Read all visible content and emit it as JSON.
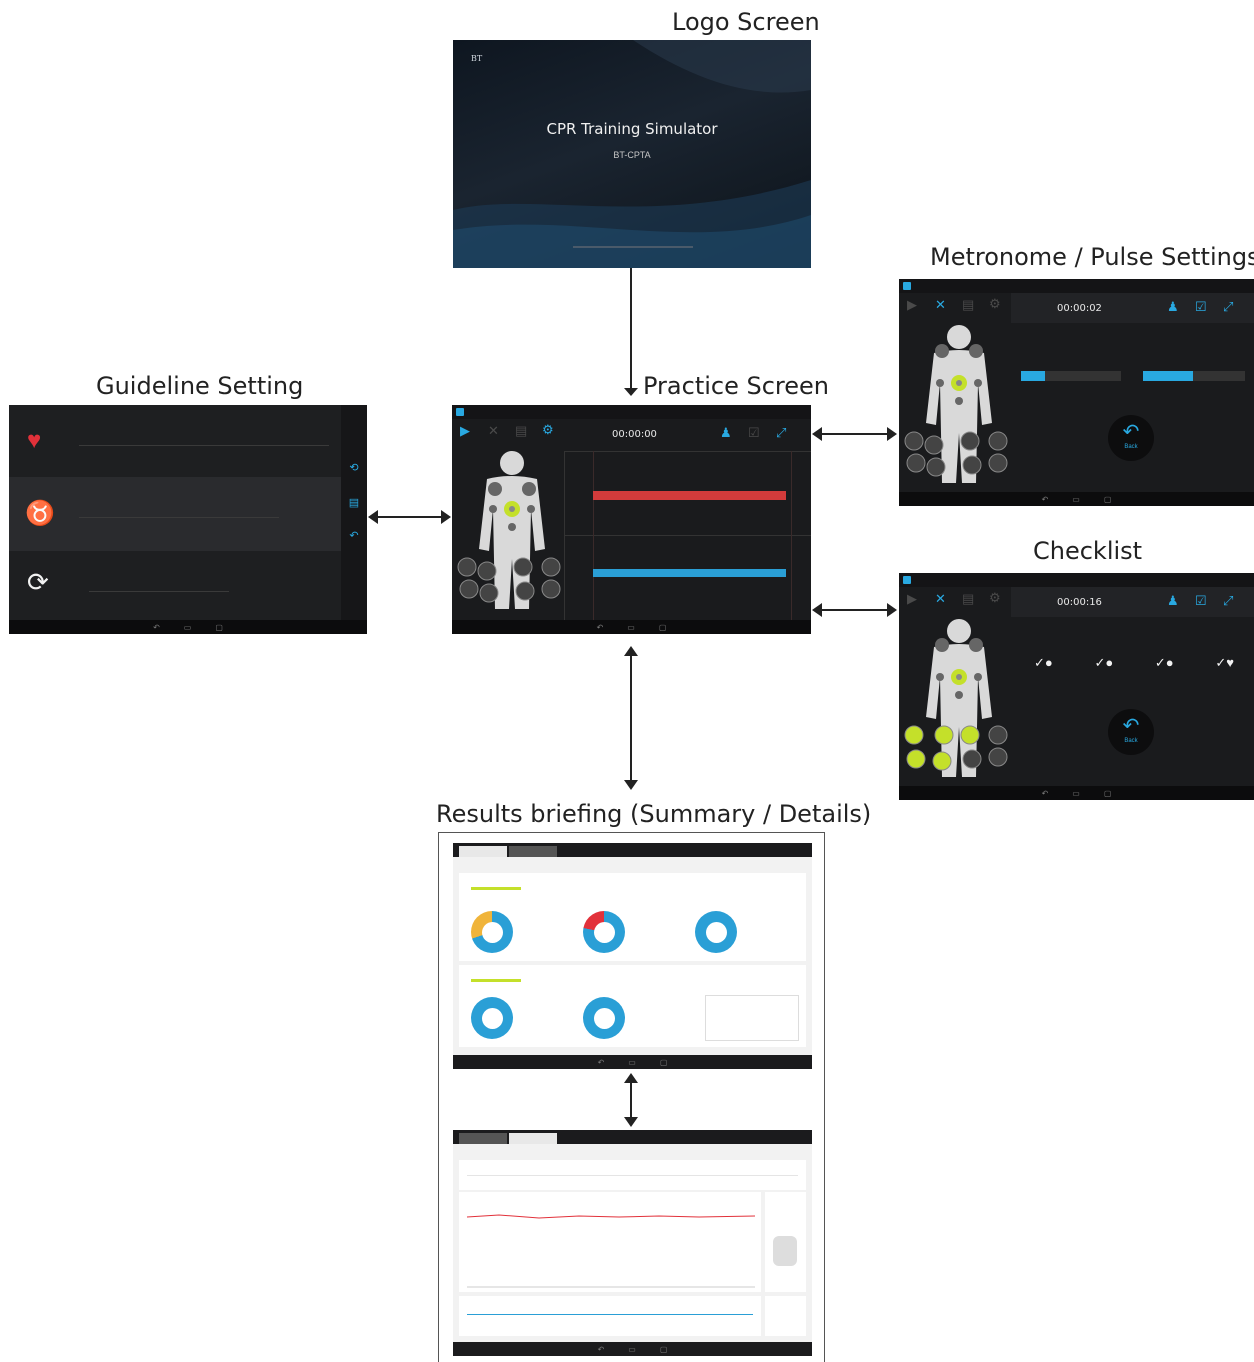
{
  "titles": {
    "logo": "Logo Screen",
    "metronome": "Metronome / Pulse Settings",
    "guideline": "Guideline Setting",
    "practice": "Practice Screen",
    "checklist": "Checklist",
    "results": "Results briefing (Summary / Details)"
  },
  "logo_screen": {
    "brand": "BT",
    "title": "CPR Training Simulator",
    "subtitle": "BT-CPTA"
  },
  "practice_screen": {
    "timer": "00:00:00"
  },
  "metronome_screen": {
    "timer": "00:00:02",
    "back_label": "Back"
  },
  "checklist_screen": {
    "timer": "00:00:16",
    "back_label": "Back"
  },
  "colors": {
    "accent_blue": "#29a9e1",
    "accent_green": "#c4e02a",
    "compression_red": "#d23b3b",
    "ventilation_blue": "#2a9fd6",
    "heart_red": "#e2313a",
    "lung_blue": "#2d9fd8"
  },
  "icons": [
    "heart-icon",
    "lungs-icon",
    "cycle-icon",
    "back-arrow-icon",
    "checkbox-icon",
    "play-icon",
    "close-icon",
    "gear-icon"
  ]
}
